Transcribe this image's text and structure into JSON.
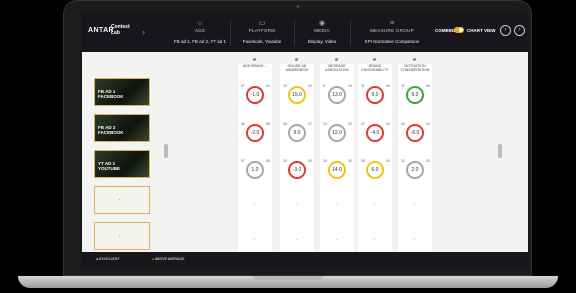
{
  "header": {
    "brand": "ANTAR",
    "product": "Context Lab",
    "columns": [
      {
        "title": "ADS",
        "value": "FB ad 1, FB ad 2, YT ad 1",
        "icon": "lightbulb-icon"
      },
      {
        "title": "PLATFORM",
        "value": "Facebook, Youtube",
        "icon": "monitor-icon"
      },
      {
        "title": "MEDIA",
        "value": "Display, Video",
        "icon": "media-icon"
      },
      {
        "title": "MEASURE GROUP",
        "value": "KPI Normative Comparison",
        "icon": "list-icon"
      }
    ],
    "combine_label": "COMBINE",
    "chart_view_label": "CHART VIEW"
  },
  "ads": [
    {
      "label_line1": "FB AD 1",
      "label_line2": "FACEBOOK"
    },
    {
      "label_line1": "FB AD 2",
      "label_line2": "FACEBOOK"
    },
    {
      "label_line1": "YT AD 1",
      "label_line2": "YOUTUBE"
    },
    {
      "label_line1": "-",
      "label_line2": ""
    },
    {
      "label_line1": "-",
      "label_line2": ""
    }
  ],
  "metrics": [
    {
      "header": "ADS BRAND…",
      "scores": [
        {
          "v": "-1.0",
          "a": "67",
          "b": "61",
          "color": "red"
        },
        {
          "v": "-2.0",
          "a": "56",
          "b": "58",
          "color": "red"
        },
        {
          "v": "1.0",
          "a": "57",
          "b": "56",
          "color": "gray"
        }
      ]
    },
    {
      "header": "ONLINE AD AWARENESS",
      "scores": [
        {
          "v": "15.0",
          "a": "15",
          "b": "30",
          "color": "yellow"
        },
        {
          "v": "9.0",
          "a": "36",
          "b": "27",
          "color": "gray"
        },
        {
          "v": "-3.0",
          "a": "15",
          "b": "30",
          "color": "red"
        }
      ]
    },
    {
      "header": "MESSAGE ASSOCIATION",
      "scores": [
        {
          "v": "13.0",
          "a": "5",
          "b": "16",
          "color": "gray"
        },
        {
          "v": "12.0",
          "a": "10",
          "b": "20",
          "color": "gray"
        },
        {
          "v": "14.0",
          "a": "16",
          "b": "30",
          "color": "yellow"
        }
      ]
    },
    {
      "header": "BRAND FAVOURABILITY",
      "scores": [
        {
          "v": "9.0",
          "a": "31",
          "b": "40",
          "color": "red"
        },
        {
          "v": "-4.0",
          "a": "47",
          "b": "43",
          "color": "red"
        },
        {
          "v": "6.0",
          "a": "38",
          "b": "44",
          "color": "yellow"
        }
      ]
    },
    {
      "header": "MOTIVATION CONSIDERATION",
      "scores": [
        {
          "v": "9.0",
          "a": "31",
          "b": "40",
          "color": "green"
        },
        {
          "v": "-6.0",
          "a": "40",
          "b": "34",
          "color": "red"
        },
        {
          "v": "2.0",
          "a": "31",
          "b": "33",
          "color": "gray"
        }
      ]
    }
  ],
  "dash": "-",
  "legend": [
    "EXCELLENT",
    "ABOVE AVERAGE"
  ],
  "colors": {
    "red": "#e03a3a",
    "yellow": "#f0c419",
    "gray": "#a9a9a2",
    "green": "#3aa640",
    "accent": "#f2a52b"
  }
}
